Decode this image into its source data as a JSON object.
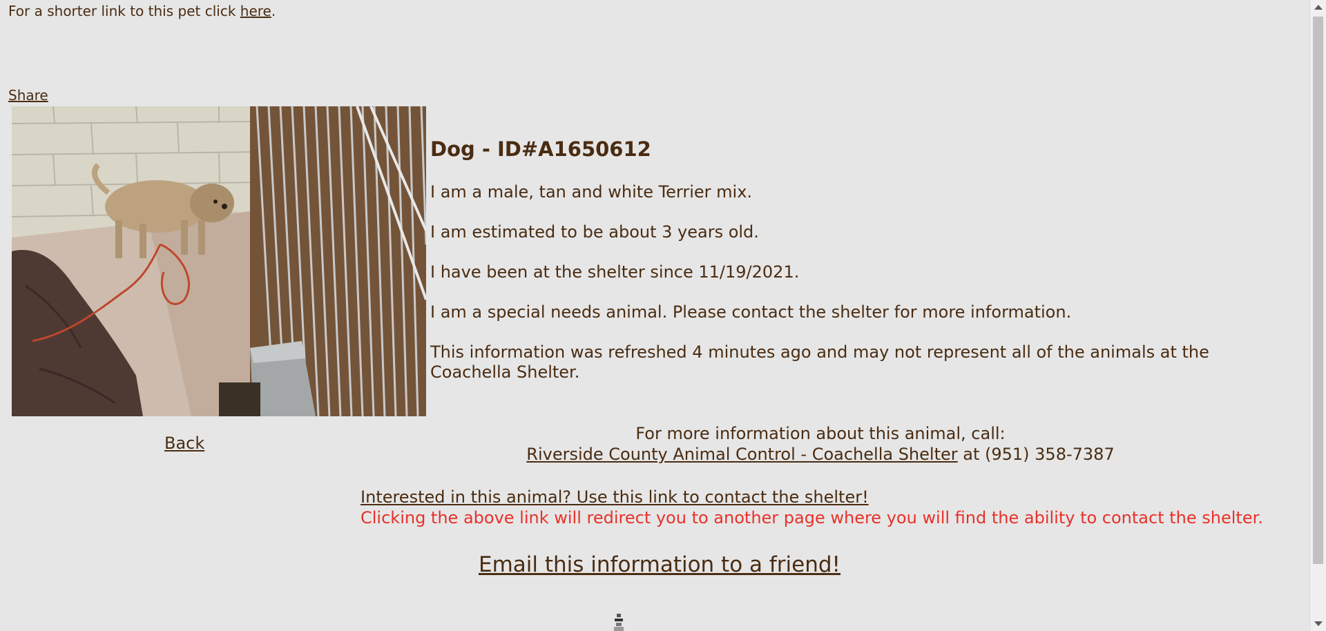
{
  "top": {
    "short_link_prefix": "For a shorter link to this pet click ",
    "short_link_text": "here",
    "short_link_suffix": ".",
    "share_label": "Share"
  },
  "pet": {
    "title": "Dog - ID#A1650612",
    "lines": [
      "I am a male, tan and white Terrier mix.",
      "I am estimated to be about 3 years old.",
      "I have been at the shelter since 11/19/2021.",
      "I am a special needs animal. Please contact the shelter for more information.",
      "This information was refreshed 4 minutes ago and may not represent all of the animals at the Coachella Shelter."
    ]
  },
  "nav": {
    "back_label": "Back"
  },
  "contact": {
    "call_text": "For more information about this animal, call:",
    "shelter_link": "Riverside County Animal Control - Coachella Shelter",
    "phone_text": " at (951) 358-7387",
    "interested_link": "Interested in this animal? Use this link to contact the shelter!",
    "redirect_note": "Clicking the above link will redirect you to another page where you will find the ability to contact the shelter.",
    "email_link": "Email this information to a friend!"
  },
  "colors": {
    "background": "#e6e6e6",
    "text": "#4a2c12",
    "warning": "#e8312a"
  },
  "icons": {
    "loading": "spinner-icon"
  }
}
